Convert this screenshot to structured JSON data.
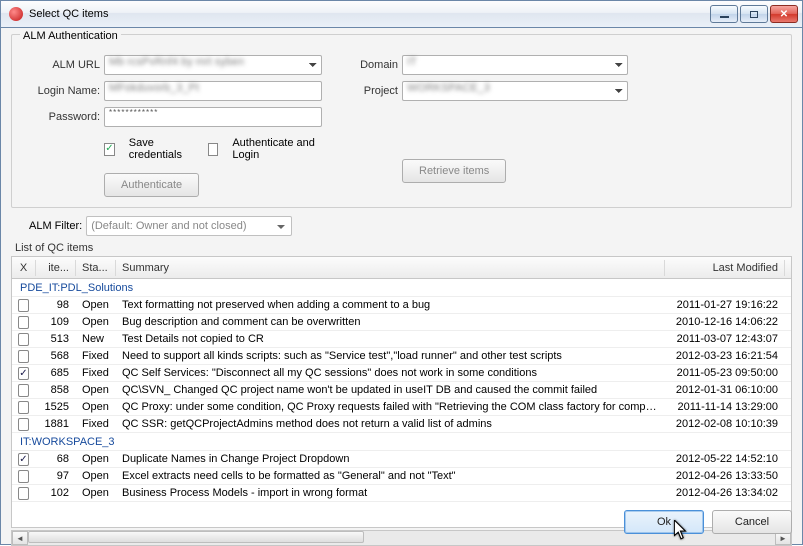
{
  "window": {
    "title": "Select QC items"
  },
  "auth": {
    "legend": "ALM Authentication",
    "alm_url_label": "ALM URL",
    "alm_url_value": "",
    "login_label": "Login Name:",
    "login_value": "",
    "password_label": "Password:",
    "password_value": "************",
    "domain_label": "Domain",
    "domain_value": "IT",
    "project_label": "Project",
    "project_value": "WORKSPACE_3",
    "save_credentials_label": "Save credentials",
    "save_credentials_checked": true,
    "auth_and_login_label": "Authenticate and Login",
    "auth_and_login_checked": false,
    "authenticate_btn": "Authenticate",
    "retrieve_btn": "Retrieve items"
  },
  "filter": {
    "label": "ALM Filter:",
    "value": "(Default: Owner and not closed)"
  },
  "list_label": "List of QC items",
  "columns": {
    "chk": "X",
    "id": "ite...",
    "status": "Sta...",
    "summary": "Summary",
    "modified": "Last Modified"
  },
  "groups": [
    {
      "name": "PDE_IT:PDL_Solutions",
      "rows": [
        {
          "checked": false,
          "id": "98",
          "status": "Open",
          "summary": "Text formatting not preserved when adding a comment to a bug",
          "modified": "2011-01-27 19:16:22"
        },
        {
          "checked": false,
          "id": "109",
          "status": "Open",
          "summary": "Bug description and comment can be overwritten",
          "modified": "2010-12-16 14:06:22"
        },
        {
          "checked": false,
          "id": "513",
          "status": "New",
          "summary": "Test Details not copied to CR",
          "modified": "2011-03-07 12:43:07"
        },
        {
          "checked": false,
          "id": "568",
          "status": "Fixed",
          "summary": "Need to support all kinds scripts: such as \"Service test\",\"load runner\" and other test scripts",
          "modified": "2012-03-23 16:21:54"
        },
        {
          "checked": true,
          "id": "685",
          "status": "Fixed",
          "summary": "QC Self Services: \"Disconnect all my QC sessions\" does not work in some conditions",
          "modified": "2011-05-23 09:50:00"
        },
        {
          "checked": false,
          "id": "858",
          "status": "Open",
          "summary": "QC\\SVN_ Changed QC project name won't be updated in useIT DB and caused the commit failed",
          "modified": "2012-01-31 06:10:00"
        },
        {
          "checked": false,
          "id": "1525",
          "status": "Open",
          "summary": "QC Proxy: under some condition, QC Proxy requests failed with \"Retrieving the COM class factory for component with CLSID ...\"",
          "modified": "2011-11-14 13:29:00"
        },
        {
          "checked": false,
          "id": "1881",
          "status": "Fixed",
          "summary": "QC SSR: getQCProjectAdmins method does not return a valid list of admins",
          "modified": "2012-02-08 10:10:39"
        }
      ]
    },
    {
      "name": "IT:WORKSPACE_3",
      "rows": [
        {
          "checked": true,
          "id": "68",
          "status": "Open",
          "summary": "Duplicate Names in Change Project Dropdown",
          "modified": "2012-05-22 14:52:10"
        },
        {
          "checked": false,
          "id": "97",
          "status": "Open",
          "summary": "Excel extracts need cells to be formatted as \"General\" and not \"Text\"",
          "modified": "2012-04-26 13:33:50"
        },
        {
          "checked": false,
          "id": "102",
          "status": "Open",
          "summary": "Business Process Models - import in wrong format",
          "modified": "2012-04-26 13:34:02"
        }
      ]
    }
  ],
  "footer": {
    "ok": "Ok",
    "cancel": "Cancel"
  }
}
